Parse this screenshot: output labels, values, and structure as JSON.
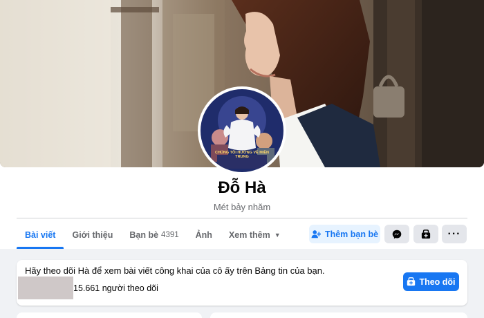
{
  "profile": {
    "name": "Đỗ Hà",
    "subtitle": "Mét bảy nhăm",
    "avatar_banner_text": "CHÚNG TÔI HƯỚNG VỀ MIỀN TRUNG"
  },
  "tabs": [
    {
      "label": "Bài viết",
      "active": true
    },
    {
      "label": "Giới thiệu"
    },
    {
      "label": "Bạn bè",
      "count": "4391"
    },
    {
      "label": "Ảnh"
    },
    {
      "label": "Xem thêm"
    }
  ],
  "actions": {
    "add_friend_label": "Thêm bạn bè",
    "messenger_icon": "messenger-icon",
    "follow_icon": "follow-icon",
    "more_icon": "more-icon"
  },
  "follow_card": {
    "message": "Hãy theo dõi Hà để xem bài viết công khai của cô ấy trên Bảng tin của bạn.",
    "followers": "15.661 người theo dõi",
    "follow_label": "Theo dõi"
  },
  "colors": {
    "accent": "#1877f2",
    "accent_light": "#e7f3ff",
    "background": "#f0f2f5"
  }
}
